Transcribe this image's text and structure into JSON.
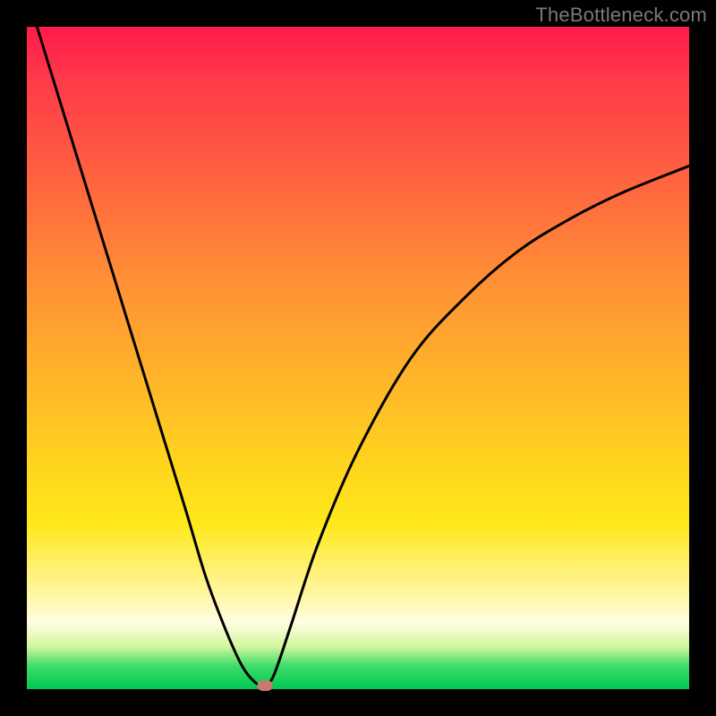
{
  "watermark": "TheBottleneck.com",
  "chart_data": {
    "type": "line",
    "title": "",
    "xlabel": "",
    "ylabel": "",
    "xlim": [
      0,
      100
    ],
    "ylim": [
      0,
      100
    ],
    "series": [
      {
        "name": "bottleneck-curve",
        "x": [
          0,
          4,
          8,
          12,
          16,
          20,
          24,
          27,
          30,
          32.5,
          34.5,
          36,
          37,
          38,
          40,
          44,
          50,
          58,
          66,
          74,
          82,
          90,
          100
        ],
        "y": [
          105,
          92,
          79,
          66,
          53,
          40,
          27,
          17,
          9,
          3.5,
          1.0,
          0.5,
          1.5,
          4,
          10,
          22,
          36,
          50,
          59,
          66,
          71,
          75,
          79
        ]
      }
    ],
    "marker": {
      "x": 36,
      "y": 0.5
    },
    "gradient_stops": [
      {
        "pos": 0.0,
        "color": "#ff1a4b"
      },
      {
        "pos": 0.38,
        "color": "#ff8f35"
      },
      {
        "pos": 0.75,
        "color": "#ffe81a"
      },
      {
        "pos": 0.92,
        "color": "#fffde0"
      },
      {
        "pos": 1.0,
        "color": "#00c853"
      }
    ]
  }
}
